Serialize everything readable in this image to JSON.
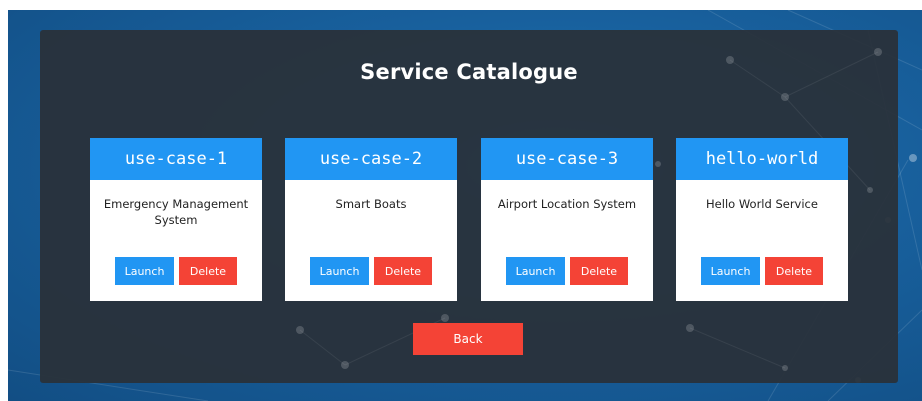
{
  "page": {
    "title": "Service Catalogue",
    "back_label": "Back"
  },
  "cards": [
    {
      "name": "use-case-1",
      "description": "Emergency Management System",
      "launch_label": "Launch",
      "delete_label": "Delete"
    },
    {
      "name": "use-case-2",
      "description": "Smart Boats",
      "launch_label": "Launch",
      "delete_label": "Delete"
    },
    {
      "name": "use-case-3",
      "description": "Airport Location System",
      "launch_label": "Launch",
      "delete_label": "Delete"
    },
    {
      "name": "hello-world",
      "description": "Hello World Service",
      "launch_label": "Launch",
      "delete_label": "Delete"
    }
  ],
  "colors": {
    "primary": "#2196f3",
    "danger": "#f44336",
    "panel": "#293139",
    "background": "#18609d"
  }
}
